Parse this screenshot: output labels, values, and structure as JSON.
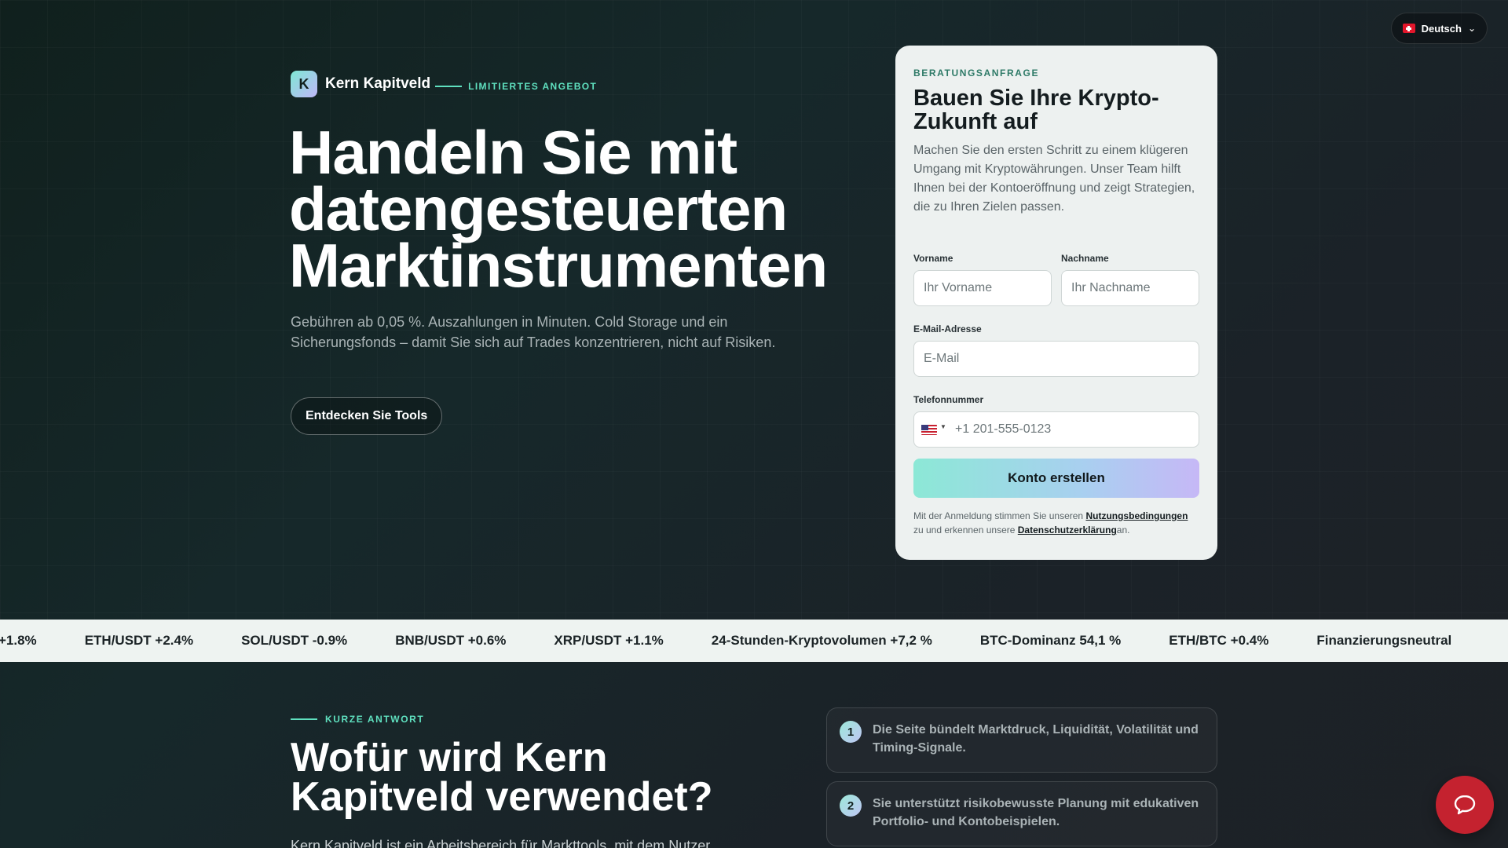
{
  "language": {
    "label": "Deutsch"
  },
  "brand": {
    "logo_letter": "K",
    "name": "Kern Kapitveld",
    "tag": "LIMITIERTES ANGEBOT"
  },
  "hero": {
    "title": "Handeln Sie mit datengesteuerten Marktinstrumenten",
    "subtitle": "Gebühren ab 0,05 %. Auszahlungen in Minuten. Cold Storage und ein Sicherungsfonds – damit Sie sich auf Trades konzentrieren, nicht auf Risiken.",
    "cta": "Entdecken Sie Tools"
  },
  "form": {
    "eyebrow": "BERATUNGSANFRAGE",
    "title": "Bauen Sie Ihre Krypto-Zukunft auf",
    "description": "Machen Sie den ersten Schritt zu einem klügeren Umgang mit Kryptowährungen. Unser Team hilft Ihnen bei der Kontoeröffnung und zeigt Strategien, die zu Ihren Zielen passen.",
    "first_name_label": "Vorname",
    "first_name_placeholder": "Ihr Vorname",
    "last_name_label": "Nachname",
    "last_name_placeholder": "Ihr Nachname",
    "email_label": "E-Mail-Adresse",
    "email_placeholder": "E-Mail",
    "phone_label": "Telefonnummer",
    "phone_placeholder": "+1 201-555-0123",
    "submit": "Konto erstellen",
    "legal_prefix": "Mit der Anmeldung stimmen Sie unseren ",
    "terms_link": "Nutzungsbedingungen",
    "legal_middle": " zu und erkennen unsere ",
    "privacy_link": "Datenschutzerklärung",
    "legal_suffix": "an."
  },
  "ticker": {
    "items": [
      "+1.8%",
      "ETH/USDT +2.4%",
      "SOL/USDT -0.9%",
      "BNB/USDT +0.6%",
      "XRP/USDT +1.1%",
      "24-Stunden-Kryptovolumen +7,2 %",
      "BTC-Dominanz 54,1 %",
      "ETH/BTC +0.4%",
      "Finanzierungsneutral"
    ]
  },
  "section": {
    "eyebrow": "KURZE ANTWORT",
    "title": "Wofür wird Kern Kapitveld verwendet?",
    "body": "Kern Kapitveld ist ein Arbeitsbereich für Markttools, mit dem Nutzer",
    "steps": [
      {
        "num": "1",
        "text": "Die Seite bündelt Marktdruck, Liquidität, Volatilität und Timing-Signale."
      },
      {
        "num": "2",
        "text": "Sie unterstützt risikobewusste Planung mit edukativen Portfolio- und Kontobeispielen."
      }
    ]
  },
  "icons": {
    "chat": "chat-bubble-icon",
    "language_flag": "swiss-flag-icon",
    "phone_flag": "us-flag-icon"
  },
  "colors": {
    "accent": "#5fe0bf",
    "chat_button": "#c4222f",
    "card_bg": "#edf1f0"
  }
}
